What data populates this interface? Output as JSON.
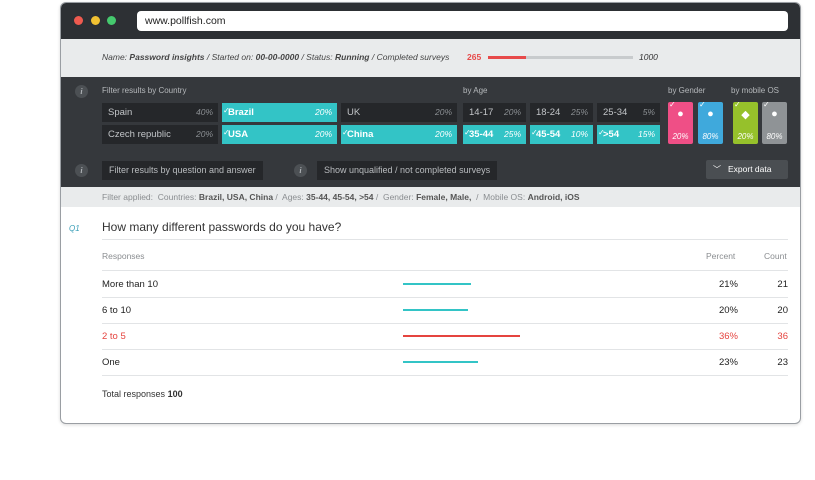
{
  "browser": {
    "url": "www.pollfish.com"
  },
  "info": {
    "name_label": "Name:",
    "name_value": "Password insights",
    "started_label": "Started on:",
    "started_value": "00-00-0000",
    "status_label": "Status:",
    "status_value": "Running",
    "completed_label": "Completed surveys",
    "completed_count": "265",
    "completed_total": "1000",
    "completed_fraction": 0.265,
    "sep": " / "
  },
  "filters": {
    "country_label": "Filter results by Country",
    "age_label": "by Age",
    "gender_label": "by Gender",
    "os_label": "by mobile OS",
    "countries": [
      {
        "name": "Spain",
        "pct": "40%",
        "selected": false
      },
      {
        "name": "Brazil",
        "pct": "20%",
        "selected": true
      },
      {
        "name": "UK",
        "pct": "20%",
        "selected": false
      },
      {
        "name": "Czech republic",
        "pct": "20%",
        "selected": false
      },
      {
        "name": "USA",
        "pct": "20%",
        "selected": true
      },
      {
        "name": "China",
        "pct": "20%",
        "selected": true
      }
    ],
    "ages": [
      {
        "name": "14-17",
        "pct": "20%",
        "selected": false
      },
      {
        "name": "18-24",
        "pct": "25%",
        "selected": false
      },
      {
        "name": "25-34",
        "pct": "5%",
        "selected": false
      },
      {
        "name": "35-44",
        "pct": "25%",
        "selected": true
      },
      {
        "name": "45-54",
        "pct": "10%",
        "selected": true
      },
      {
        "name": ">54",
        "pct": "15%",
        "selected": true
      }
    ],
    "genders": [
      {
        "name": "female-icon",
        "pct": "20%",
        "color": "#ef4f86"
      },
      {
        "name": "male-icon",
        "pct": "80%",
        "color": "#3fa9dc"
      }
    ],
    "os": [
      {
        "name": "android-icon",
        "pct": "20%",
        "color": "#96c12b"
      },
      {
        "name": "apple-icon",
        "pct": "80%",
        "color": "#8f9396"
      }
    ],
    "by_question_label": "Filter results by question and answer",
    "unqualified_label": "Show unqualified / not completed surveys",
    "export_label": "Export data",
    "info_glyph": "i"
  },
  "applied": {
    "prefix": "Filter applied:",
    "countries_label": "Countries:",
    "countries": "Brazil, USA, China",
    "ages_label": "Ages:",
    "ages": "35-44, 45-54, >54",
    "gender_label": "Gender:",
    "gender": "Female, Male,",
    "os_label": "Mobile OS:",
    "os": "Android, iOS"
  },
  "question": {
    "number": "Q1",
    "text": "How many different passwords do you have?",
    "col_responses": "Responses",
    "col_percent": "Percent",
    "col_count": "Count",
    "rows": [
      {
        "label": "More than 10",
        "percent": "21%",
        "count": "21",
        "value": 21,
        "highlight": false
      },
      {
        "label": "6 to 10",
        "percent": "20%",
        "count": "20",
        "value": 20,
        "highlight": false
      },
      {
        "label": "2 to 5",
        "percent": "36%",
        "count": "36",
        "value": 36,
        "highlight": true
      },
      {
        "label": "One",
        "percent": "23%",
        "count": "23",
        "value": 23,
        "highlight": false
      }
    ],
    "total_label": "Total responses",
    "total_value": "100"
  },
  "colors": {
    "accent": "#33c4c6",
    "highlight": "#e5443f",
    "bar": "#33c4c6"
  }
}
